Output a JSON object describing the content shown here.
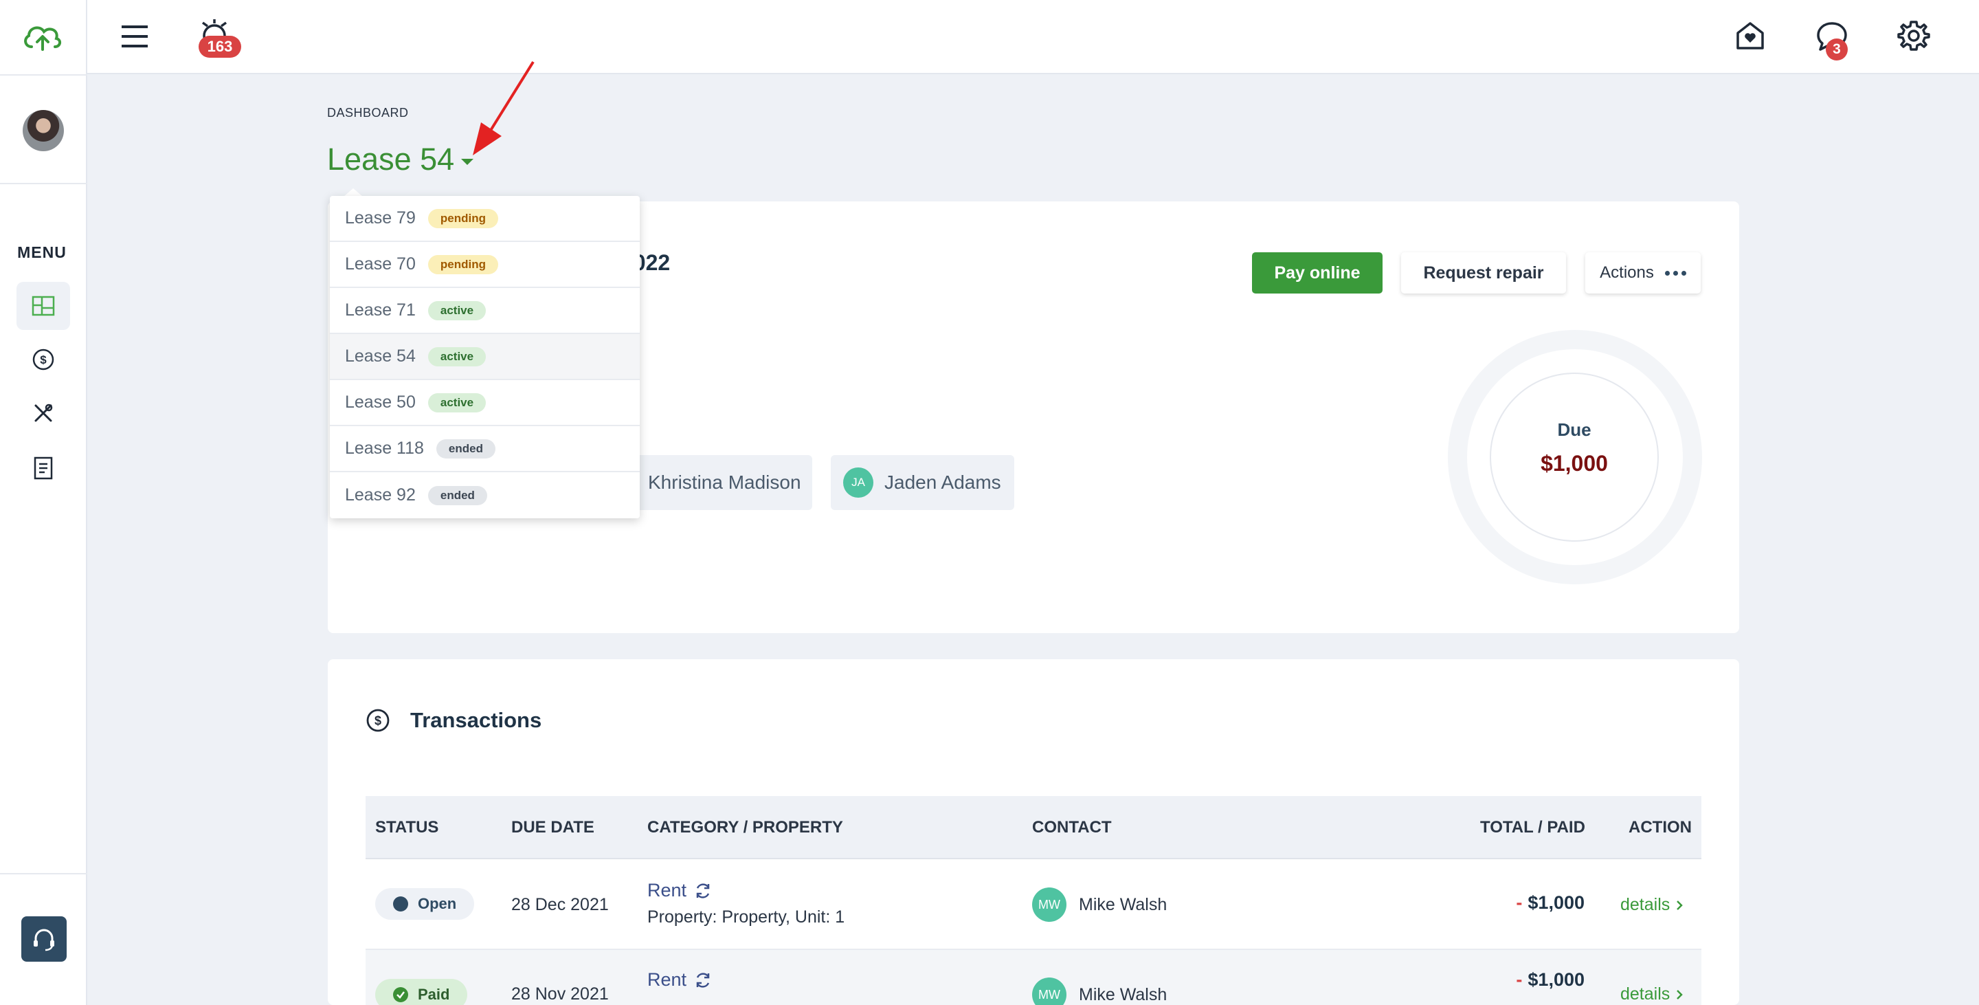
{
  "topbar": {
    "notification_count": "163",
    "message_count": "3"
  },
  "sidebar": {
    "menu_label": "MENU"
  },
  "breadcrumb": "DASHBOARD",
  "lease_title": "Lease 54",
  "dropdown": {
    "items": [
      {
        "label": "Lease 79",
        "status": "pending"
      },
      {
        "label": "Lease 70",
        "status": "pending"
      },
      {
        "label": "Lease 71",
        "status": "active"
      },
      {
        "label": "Lease 54",
        "status": "active"
      },
      {
        "label": "Lease 50",
        "status": "active"
      },
      {
        "label": "Lease 118",
        "status": "ended"
      },
      {
        "label": "Lease 92",
        "status": "ended"
      }
    ]
  },
  "lease_card": {
    "year_fragment": "2022",
    "pay_label": "Pay online",
    "repair_label": "Request repair",
    "actions_label": "Actions",
    "tenants": [
      {
        "name": "Khristina Madison"
      },
      {
        "initials": "JA",
        "name": "Jaden Adams"
      }
    ],
    "due_label": "Due",
    "due_value": "$1,000"
  },
  "transactions": {
    "title": "Transactions",
    "headers": [
      "STATUS",
      "DUE DATE",
      "CATEGORY / PROPERTY",
      "CONTACT",
      "TOTAL / PAID",
      "ACTION"
    ],
    "rows": [
      {
        "status": "Open",
        "due_date": "28 Dec 2021",
        "category": "Rent",
        "property": "Property: Property, Unit: 1",
        "contact_initials": "MW",
        "contact": "Mike Walsh",
        "minus": "-",
        "total": "$1,000",
        "action": "details"
      },
      {
        "status": "Paid",
        "due_date": "28 Nov 2021",
        "category": "Rent",
        "property": "",
        "contact_initials": "MW",
        "contact": "Mike Walsh",
        "minus": "-",
        "total": "$1,000",
        "action": "details"
      }
    ]
  },
  "colors": {
    "brand_green": "#3a8f35",
    "badge_red": "#d94343",
    "due_red": "#7a1010"
  }
}
